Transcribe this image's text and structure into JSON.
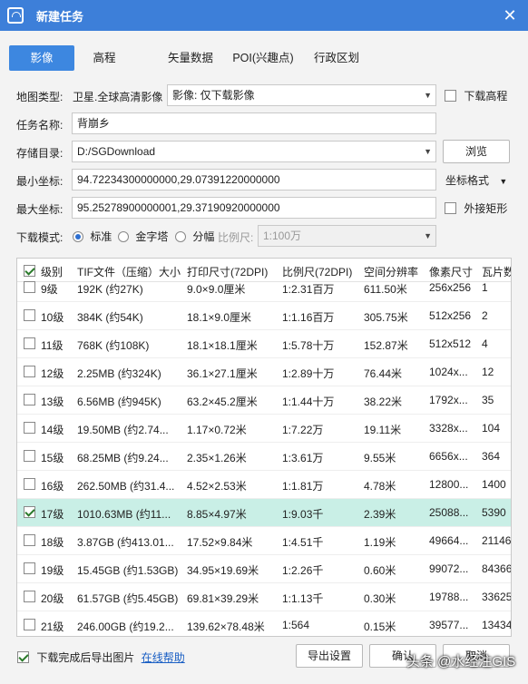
{
  "window": {
    "title": "新建任务",
    "close": "✕"
  },
  "tabs": [
    "影像",
    "高程",
    "矢量数据",
    "POI(兴趣点)",
    "行政区划"
  ],
  "form": {
    "map_type_label": "地图类型:",
    "map_type_value": "卫星.全球高清影像",
    "map_option_value": "影像: 仅下载影像",
    "download_dem_label": "下载高程",
    "task_name_label": "任务名称:",
    "task_name_value": "背崩乡",
    "storage_label": "存储目录:",
    "storage_value": "D:/SGDownload",
    "browse_label": "浏览",
    "min_coord_label": "最小坐标:",
    "min_coord_value": "94.72234300000000,29.07391220000000",
    "coord_format_label": "坐标格式",
    "max_coord_label": "最大坐标:",
    "max_coord_value": "95.25278900000001,29.37190920000000",
    "outer_rect_label": "外接矩形",
    "mode_label": "下载模式:",
    "mode_standard": "标准",
    "mode_pyramid": "金字塔",
    "mode_tile": "分幅",
    "scale_label": "比例尺:",
    "scale_value": "1:100万"
  },
  "table": {
    "headers": [
      "级别",
      "TIF文件（压缩）大小",
      "打印尺寸(72DPI)",
      "比例尺(72DPI)",
      "空间分辨率",
      "像素尺寸",
      "瓦片数"
    ],
    "rows": [
      {
        "level": "9级",
        "size": "192K (约27K)",
        "print": "9.0×9.0厘米",
        "scale": "1:2.31百万",
        "res": "611.50米",
        "pixel": "256x256",
        "tiles": "1",
        "checked": false
      },
      {
        "level": "10级",
        "size": "384K (约54K)",
        "print": "18.1×9.0厘米",
        "scale": "1:1.16百万",
        "res": "305.75米",
        "pixel": "512x256",
        "tiles": "2",
        "checked": false
      },
      {
        "level": "11级",
        "size": "768K (约108K)",
        "print": "18.1×18.1厘米",
        "scale": "1:5.78十万",
        "res": "152.87米",
        "pixel": "512x512",
        "tiles": "4",
        "checked": false
      },
      {
        "level": "12级",
        "size": "2.25MB (约324K)",
        "print": "36.1×27.1厘米",
        "scale": "1:2.89十万",
        "res": "76.44米",
        "pixel": "1024x...",
        "tiles": "12",
        "checked": false
      },
      {
        "level": "13级",
        "size": "6.56MB (约945K)",
        "print": "63.2×45.2厘米",
        "scale": "1:1.44十万",
        "res": "38.22米",
        "pixel": "1792x...",
        "tiles": "35",
        "checked": false
      },
      {
        "level": "14级",
        "size": "19.50MB (约2.74...",
        "print": "1.17×0.72米",
        "scale": "1:7.22万",
        "res": "19.11米",
        "pixel": "3328x...",
        "tiles": "104",
        "checked": false
      },
      {
        "level": "15级",
        "size": "68.25MB (约9.24...",
        "print": "2.35×1.26米",
        "scale": "1:3.61万",
        "res": "9.55米",
        "pixel": "6656x...",
        "tiles": "364",
        "checked": false
      },
      {
        "level": "16级",
        "size": "262.50MB (约31.4...",
        "print": "4.52×2.53米",
        "scale": "1:1.81万",
        "res": "4.78米",
        "pixel": "12800...",
        "tiles": "1400",
        "checked": false
      },
      {
        "level": "17级",
        "size": "1010.63MB (约11...",
        "print": "8.85×4.97米",
        "scale": "1:9.03千",
        "res": "2.39米",
        "pixel": "25088...",
        "tiles": "5390",
        "checked": true
      },
      {
        "level": "18级",
        "size": "3.87GB (约413.01...",
        "print": "17.52×9.84米",
        "scale": "1:4.51千",
        "res": "1.19米",
        "pixel": "49664...",
        "tiles": "21146",
        "checked": false
      },
      {
        "level": "19级",
        "size": "15.45GB (约1.53GB)",
        "print": "34.95×19.69米",
        "scale": "1:2.26千",
        "res": "0.60米",
        "pixel": "99072...",
        "tiles": "84366",
        "checked": false
      },
      {
        "level": "20级",
        "size": "61.57GB (约5.45GB)",
        "print": "69.81×39.29米",
        "scale": "1:1.13千",
        "res": "0.30米",
        "pixel": "19788...",
        "tiles": "33625",
        "checked": false
      },
      {
        "level": "21级",
        "size": "246.00GB (约19.2...",
        "print": "139.62×78.48米",
        "scale": "1:564",
        "res": "0.15米",
        "pixel": "39577...",
        "tiles": "13434",
        "checked": false
      }
    ]
  },
  "footer": {
    "export_after_label": "下载完成后导出图片",
    "help_link": "在线帮助",
    "export_settings": "导出设置",
    "ok": "确认",
    "cancel": "取消"
  },
  "watermark": "头条 @水经注GIS"
}
